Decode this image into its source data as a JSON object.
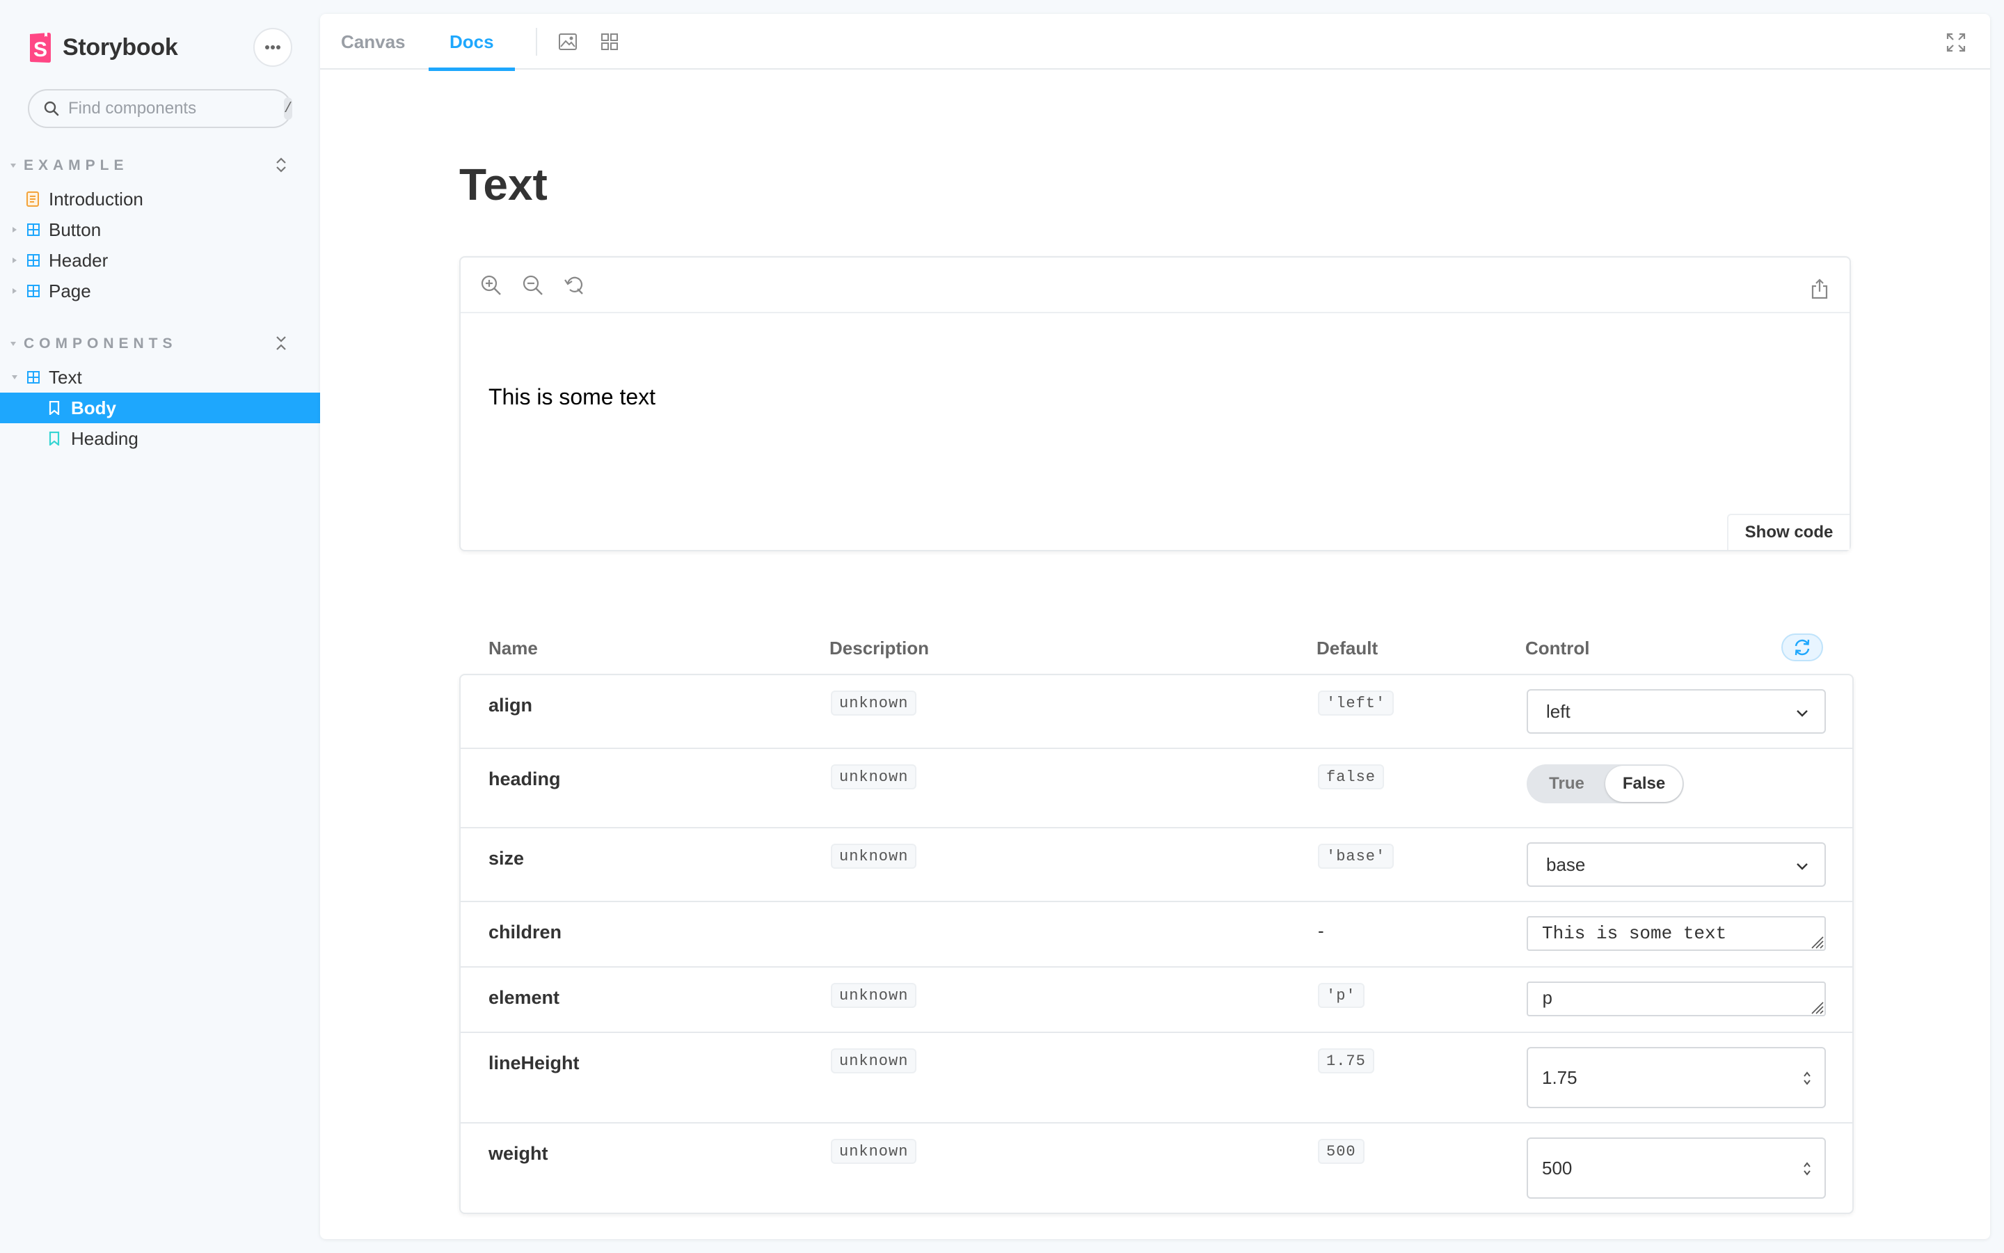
{
  "app": {
    "brand": "Storybook",
    "accent": "#1ea7fd",
    "brand_color": "#ff4785"
  },
  "sidebar": {
    "search_placeholder": "Find components",
    "search_shortcut": "/",
    "sections": [
      {
        "title": "EXAMPLE",
        "items": [
          {
            "label": "Introduction",
            "icon": "document-icon"
          },
          {
            "label": "Button",
            "icon": "component-icon"
          },
          {
            "label": "Header",
            "icon": "component-icon"
          },
          {
            "label": "Page",
            "icon": "component-icon"
          }
        ]
      },
      {
        "title": "COMPONENTS",
        "items": [
          {
            "label": "Text",
            "icon": "component-icon"
          },
          {
            "label": "Body",
            "icon": "bookmark-icon",
            "selected": true
          },
          {
            "label": "Heading",
            "icon": "bookmark-icon"
          }
        ]
      }
    ]
  },
  "toolbar": {
    "tabs": [
      {
        "label": "Canvas",
        "active": false
      },
      {
        "label": "Docs",
        "active": true
      }
    ]
  },
  "docs": {
    "title": "Text",
    "preview_text": "This is some text",
    "show_code": "Show code"
  },
  "args_table": {
    "headers": {
      "name": "Name",
      "description": "Description",
      "default": "Default",
      "control": "Control"
    },
    "rows": [
      {
        "name": "align",
        "description": "unknown",
        "default": "'left'",
        "control": {
          "type": "select",
          "value": "left"
        }
      },
      {
        "name": "heading",
        "description": "unknown",
        "default": "false",
        "control": {
          "type": "boolean",
          "true_label": "True",
          "false_label": "False",
          "value": false
        }
      },
      {
        "name": "size",
        "description": "unknown",
        "default": "'base'",
        "control": {
          "type": "select",
          "value": "base"
        }
      },
      {
        "name": "children",
        "description": "",
        "default": "-",
        "control": {
          "type": "text",
          "value": "This is some text"
        }
      },
      {
        "name": "element",
        "description": "unknown",
        "default": "'p'",
        "control": {
          "type": "text",
          "value": "p"
        }
      },
      {
        "name": "lineHeight",
        "description": "unknown",
        "default": "1.75",
        "control": {
          "type": "number",
          "value": "1.75"
        }
      },
      {
        "name": "weight",
        "description": "unknown",
        "default": "500",
        "control": {
          "type": "number",
          "value": "500"
        }
      }
    ]
  }
}
